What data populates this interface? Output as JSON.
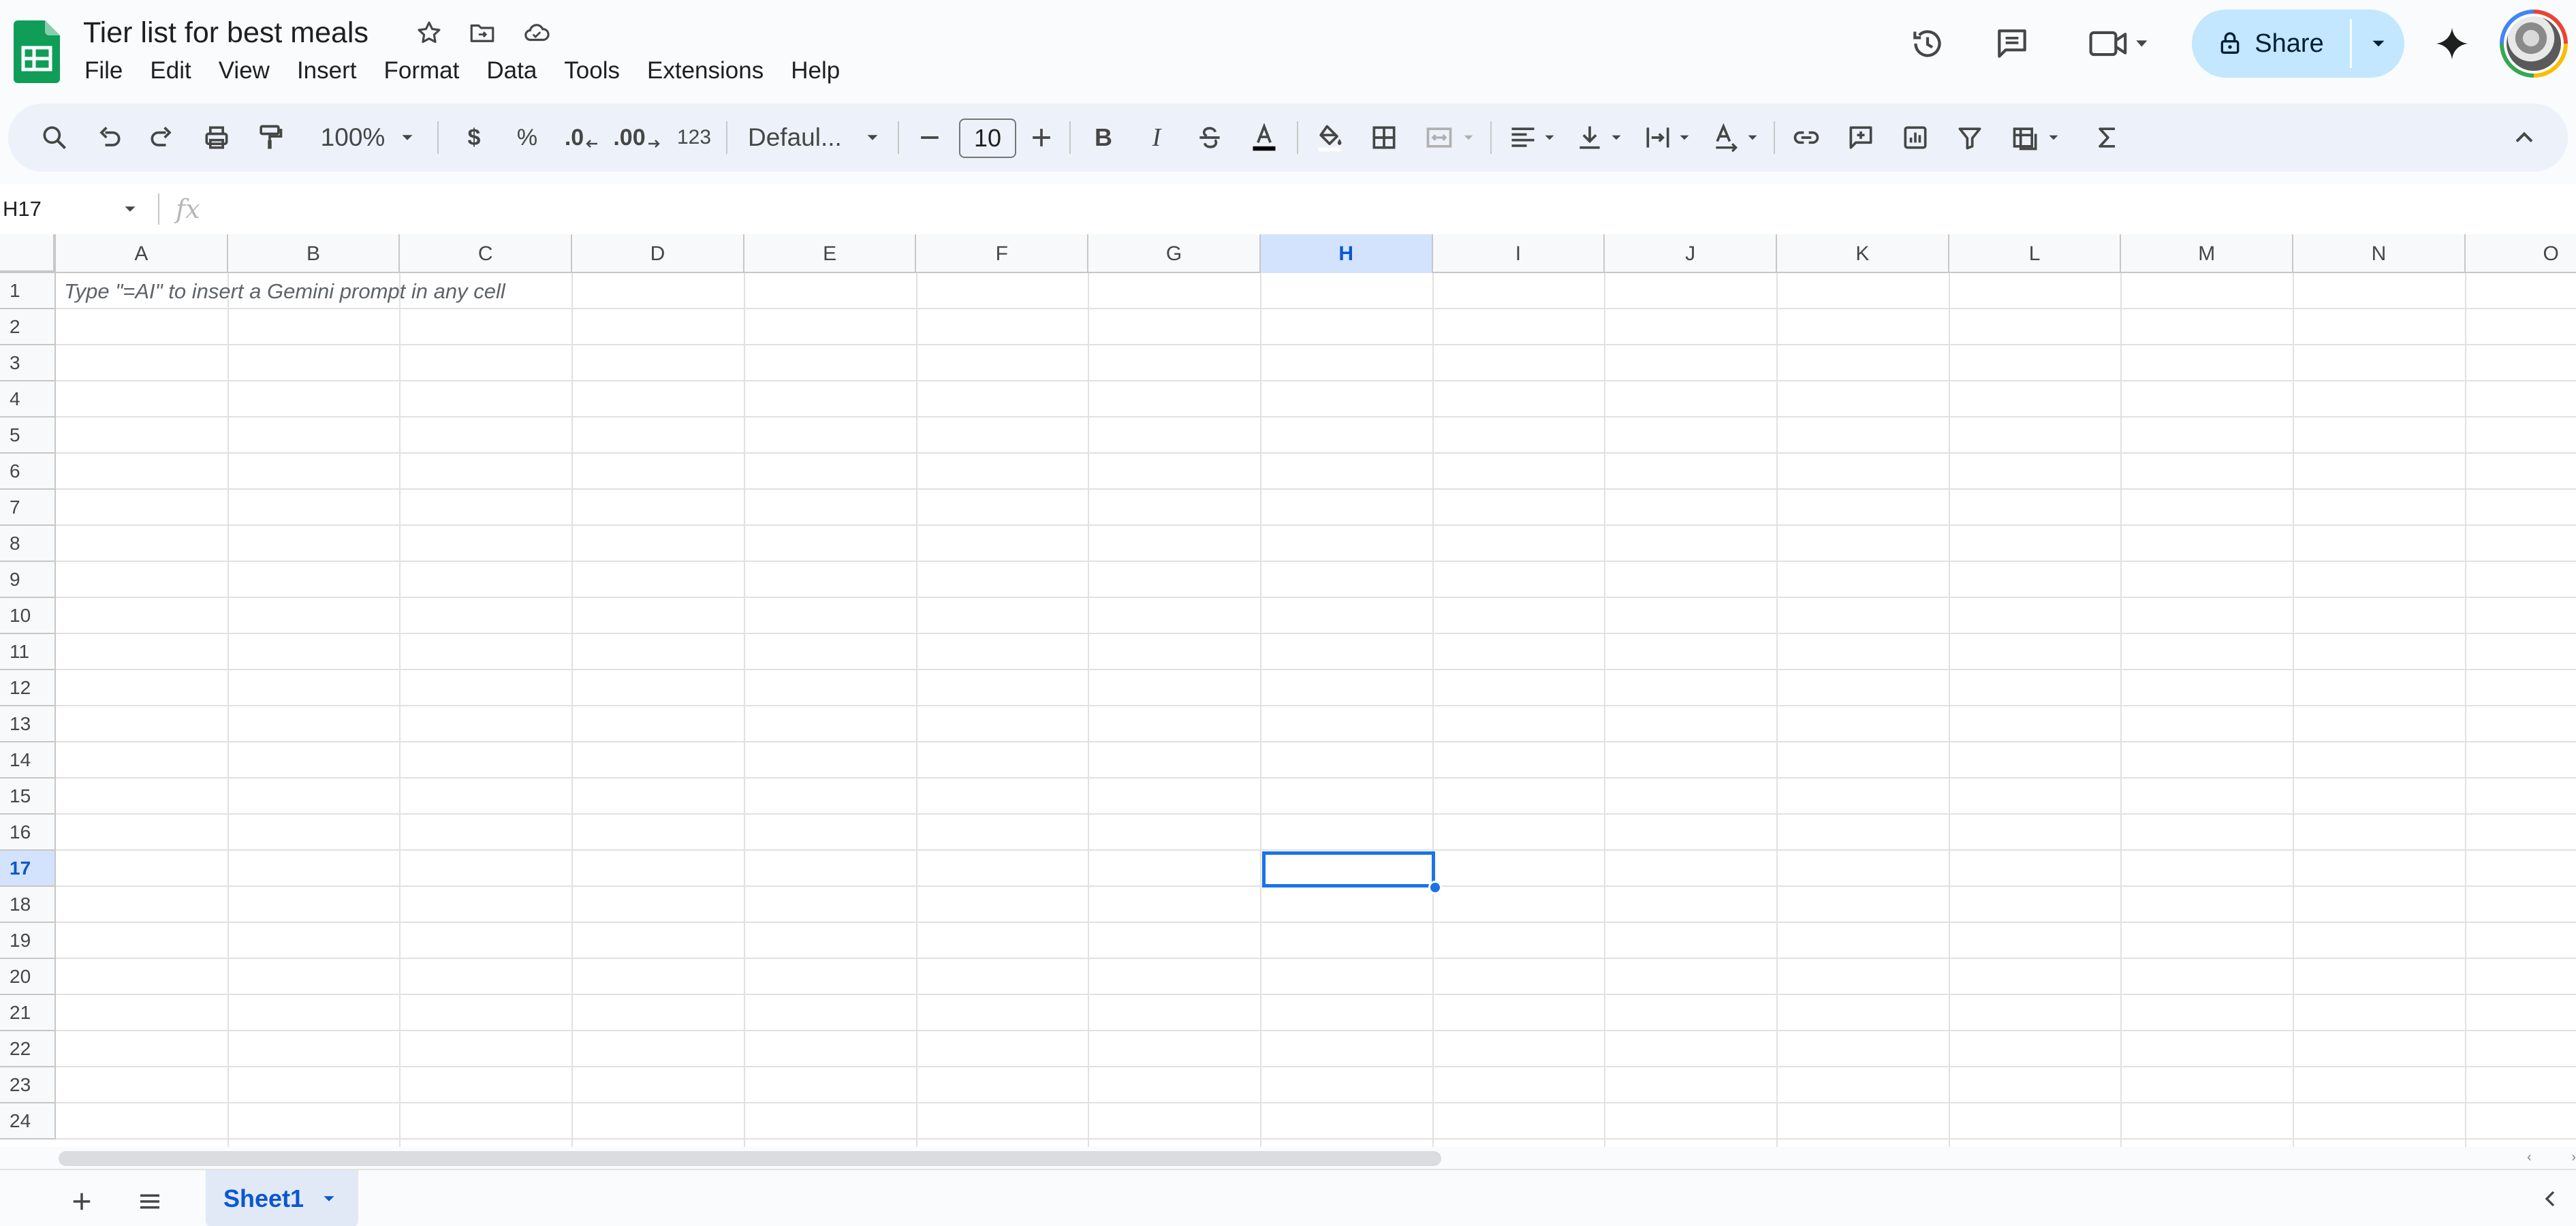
{
  "doc": {
    "title": "Tier list for best meals"
  },
  "menu": [
    "File",
    "Edit",
    "View",
    "Insert",
    "Format",
    "Data",
    "Tools",
    "Extensions",
    "Help"
  ],
  "header": {
    "share_label": "Share"
  },
  "toolbar": {
    "zoom": "100%",
    "currency": "$",
    "percent": "%",
    "decrease_decimal": ".0",
    "increase_decimal": ".00",
    "number_format": "123",
    "font": "Defaul...",
    "font_size": "10",
    "bold": "B",
    "italic": "I"
  },
  "formula_bar": {
    "name_box": "H17",
    "fx": "fx"
  },
  "grid": {
    "columns": [
      "A",
      "B",
      "C",
      "D",
      "E",
      "F",
      "G",
      "H",
      "I",
      "J",
      "K",
      "L",
      "M",
      "N",
      "O"
    ],
    "rows": [
      "1",
      "2",
      "3",
      "4",
      "5",
      "6",
      "7",
      "8",
      "9",
      "10",
      "11",
      "12",
      "13",
      "14",
      "15",
      "16",
      "17",
      "18",
      "19",
      "20",
      "21",
      "22",
      "23",
      "24"
    ],
    "selected_column": "H",
    "selected_row": "17",
    "cell_hint": "Type \"=AI\" to insert a Gemini prompt in any cell"
  },
  "sheets": {
    "active_tab": "Sheet1"
  },
  "colors": {
    "accent": "#1a73e8",
    "share_bg": "#c2e7ff",
    "header_selected": "#d3e3fd"
  }
}
